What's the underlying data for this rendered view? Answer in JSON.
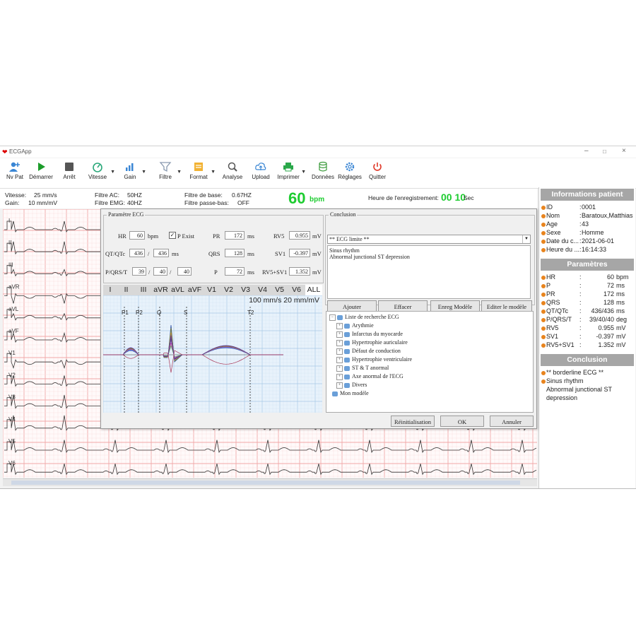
{
  "window": {
    "title": "ECGApp"
  },
  "toolbar": [
    {
      "id": "nvpat",
      "label": "Nv Pat",
      "icon": "add-user-icon",
      "dropdown": false
    },
    {
      "id": "demarrer",
      "label": "Démarrer",
      "icon": "play-icon",
      "dropdown": false
    },
    {
      "id": "arret",
      "label": "Arrêt",
      "icon": "stop-icon",
      "dropdown": false
    },
    {
      "id": "vitesse",
      "label": "Vitesse",
      "icon": "speed-icon",
      "dropdown": true
    },
    {
      "id": "gain",
      "label": "Gain",
      "icon": "gain-icon",
      "dropdown": true
    },
    {
      "id": "filtre",
      "label": "Filtre",
      "icon": "filter-icon",
      "dropdown": true
    },
    {
      "id": "format",
      "label": "Format",
      "icon": "format-icon",
      "dropdown": true
    },
    {
      "id": "analyse",
      "label": "Analyse",
      "icon": "analyse-icon",
      "dropdown": false
    },
    {
      "id": "upload",
      "label": "Upload",
      "icon": "upload-icon",
      "dropdown": false
    },
    {
      "id": "imprimer",
      "label": "Imprimer",
      "icon": "print-icon",
      "dropdown": true
    },
    {
      "id": "donnees",
      "label": "Données",
      "icon": "database-icon",
      "dropdown": false
    },
    {
      "id": "reglages",
      "label": "Réglages",
      "icon": "gear-icon",
      "dropdown": false
    },
    {
      "id": "quitter",
      "label": "Quitter",
      "icon": "power-icon",
      "dropdown": false
    }
  ],
  "status": {
    "vitesse_label": "Vitesse:",
    "vitesse_value": "25 mm/s",
    "gain_label": "Gain:",
    "gain_value": "10 mm/mV",
    "filtre_ac_label": "Filtre AC:",
    "filtre_ac_value": "50HZ",
    "filtre_emg_label": "Filtre EMG:",
    "filtre_emg_value": "40HZ",
    "filtre_base_label": "Filtre de base:",
    "filtre_base_value": "0.67HZ",
    "filtre_passe_bas_label": "Filtre passe-bas:",
    "filtre_passe_bas_value": "OFF",
    "bpm_value": "60",
    "bpm_unit": "bpm",
    "heure_label": "Heure de l'enregistrement:",
    "heure_value": "00 10",
    "heure_unit": "Sec"
  },
  "leads": [
    "I",
    "II",
    "III",
    "aVR",
    "aVL",
    "aVF",
    "V1",
    "V2",
    "V3",
    "V4",
    "V5",
    "V6"
  ],
  "dialog": {
    "param_title": "Paramètre ECG",
    "hr_label": "HR",
    "hr_value": "60",
    "hr_unit": "bpm",
    "pexist_label": "P Exist",
    "pexist_checked": true,
    "pr_label": "PR",
    "pr_value": "172",
    "pr_unit": "ms",
    "rv5_label": "RV5",
    "rv5_value": "0.955",
    "rv5_unit": "mV",
    "qt_label": "QT/QTc",
    "qt_value": "436",
    "qtc_value": "436",
    "qt_unit": "ms",
    "qrs_label": "QRS",
    "qrs_value": "128",
    "qrs_unit": "ms",
    "sv1_label": "SV1",
    "sv1_value": "-0.397",
    "sv1_unit": "mV",
    "pqrst_label": "P/QRS/T",
    "p_axis": "39",
    "qrs_axis": "40",
    "t_axis": "40",
    "p_label": "P",
    "p_value": "72",
    "p_unit": "ms",
    "rvsv_label": "RV5+SV1",
    "rvsv_value": "1.352",
    "rvsv_unit": "mV",
    "tabs": [
      "I",
      "II",
      "III",
      "aVR",
      "aVL",
      "aVF",
      "V1",
      "V2",
      "V3",
      "V4",
      "V5",
      "V6",
      "ALL"
    ],
    "selected_tab": "ALL",
    "plot_scale": "100 mm/s  20 mm/mV",
    "markers": [
      "P1",
      "P2",
      "Q",
      "S",
      "T2"
    ],
    "conclusion_title": "Conclusion",
    "conclusion_combo": "** ECG limite **",
    "conclusion_lines": [
      "Sinus rhythm",
      "Abnormal junctional ST depression"
    ],
    "btn_ajouter": "Ajouter",
    "btn_effacer": "Effacer",
    "btn_enreg": "Enreg Modèle",
    "btn_editer": "Editer le modèle",
    "tree_root": "Liste de recherche ECG",
    "tree_items": [
      "Arythmie",
      "Infarctus du myocarde",
      "Hypertrophie auriculaire",
      "Défaut de conduction",
      "Hypertrophie ventriculaire",
      "ST & T anormal",
      "Axe anormal de l'ECG",
      "Divers"
    ],
    "tree_model": "Mon modèle",
    "btn_reinit": "Réinitialisation",
    "btn_ok": "OK",
    "btn_annuler": "Annuler"
  },
  "patient": {
    "title": "Informations patient",
    "rows": [
      {
        "k": "ID",
        "v": "0001"
      },
      {
        "k": "Nom",
        "v": "Baratoux,Matthias"
      },
      {
        "k": "Age",
        "v": "43"
      },
      {
        "k": "Sexe",
        "v": "Homme"
      },
      {
        "k": "Date du c...",
        "v": "2021-06-01"
      },
      {
        "k": "Heure du ...",
        "v": "16:14:33"
      }
    ]
  },
  "params": {
    "title": "Paramètres",
    "rows": [
      {
        "k": "HR",
        "v": "60",
        "u": "bpm"
      },
      {
        "k": "P",
        "v": "72",
        "u": "ms"
      },
      {
        "k": "PR",
        "v": "172",
        "u": "ms"
      },
      {
        "k": "QRS",
        "v": "128",
        "u": "ms"
      },
      {
        "k": "QT/QTc",
        "v": "436/436",
        "u": "ms"
      },
      {
        "k": "P/QRS/T",
        "v": "39/40/40",
        "u": "deg"
      },
      {
        "k": "RV5",
        "v": "0.955",
        "u": "mV"
      },
      {
        "k": "SV1",
        "v": "-0.397",
        "u": "mV"
      },
      {
        "k": "RV5+SV1",
        "v": "1.352",
        "u": "mV"
      }
    ]
  },
  "conclusion": {
    "title": "Conclusion",
    "lines": [
      "** borderline ECG **",
      "Sinus rhythm",
      "Abnormal junctional ST",
      "depression"
    ]
  },
  "colors": {
    "bpm_green": "#1dcc30",
    "grid_major": "#f2a8a8",
    "grid_minor": "#fbe0e0",
    "accent_orange": "#e8841e",
    "header_gray": "#a6a6a6"
  }
}
